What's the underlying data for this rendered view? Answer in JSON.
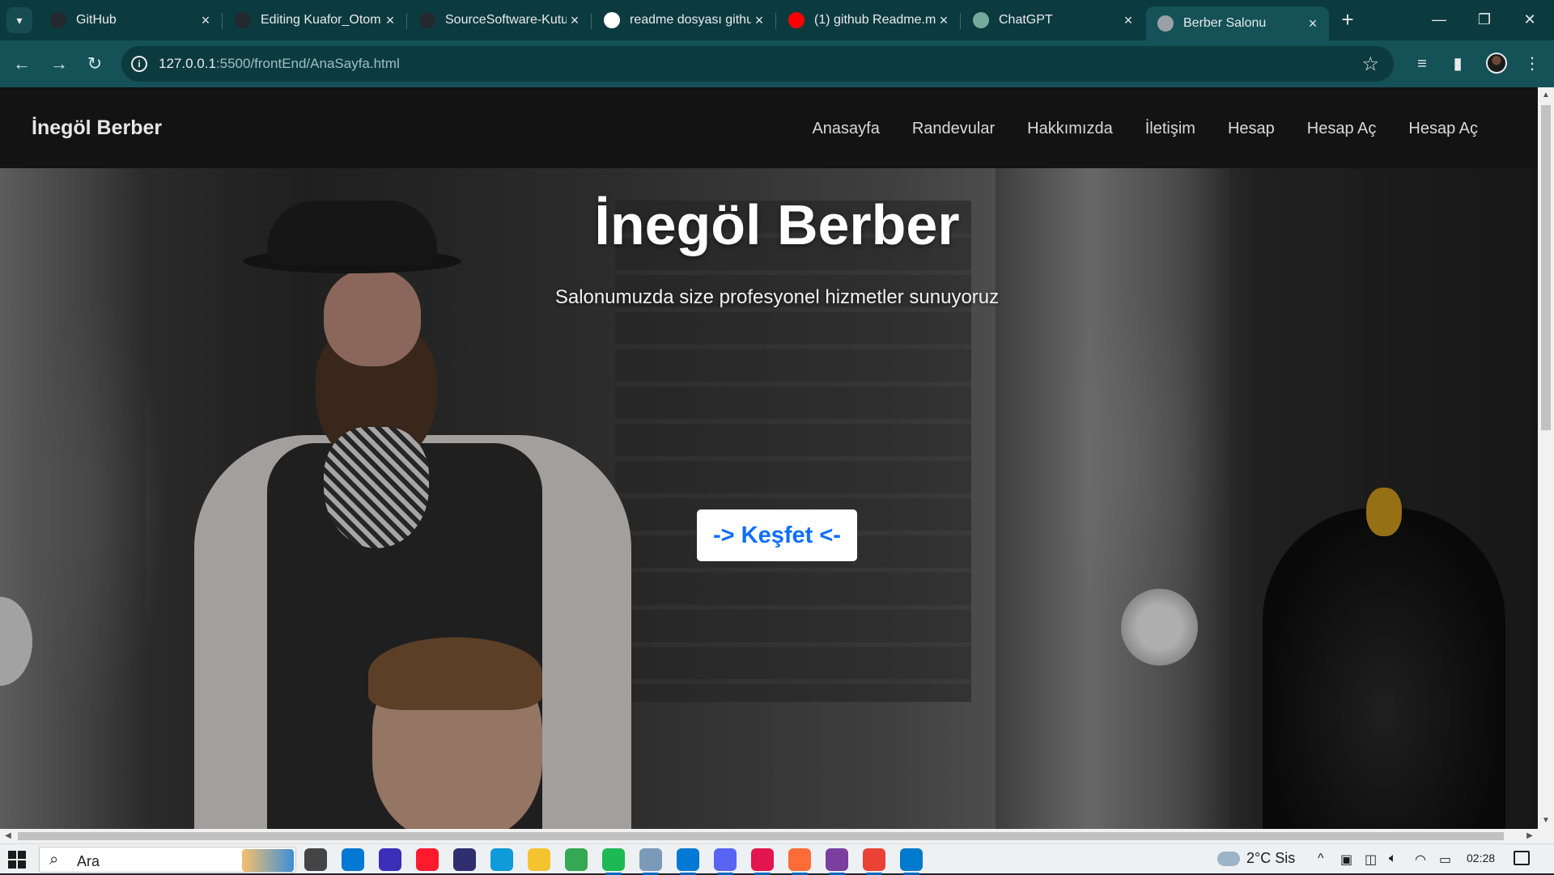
{
  "browser": {
    "tabs": [
      {
        "title": "GitHub",
        "favicon": "github-icon",
        "color": "#24292f"
      },
      {
        "title": "Editing Kuafor_Otom",
        "favicon": "github-icon",
        "color": "#24292f"
      },
      {
        "title": "SourceSoftware-Kutu",
        "favicon": "github-icon",
        "color": "#24292f"
      },
      {
        "title": "readme dosyası githu",
        "favicon": "google-icon",
        "color": "#ffffff"
      },
      {
        "title": "(1) github Readme.m",
        "favicon": "youtube-icon",
        "color": "#ff0000"
      },
      {
        "title": "ChatGPT",
        "favicon": "chatgpt-icon",
        "color": "#74aa9c"
      },
      {
        "title": "Berber Salonu",
        "favicon": "globe-icon",
        "color": "#9aa0a6"
      }
    ],
    "active_tab_index": 6,
    "address": {
      "host": "127.0.0.1",
      "rest": ":5500/frontEnd/AnaSayfa.html"
    },
    "theme_colors": {
      "tabstrip": "#0c3b3f",
      "toolbar": "#145257"
    }
  },
  "page": {
    "brand": "İnegöl Berber",
    "nav": [
      "Anasayfa",
      "Randevular",
      "Hakkımızda",
      "İletişim",
      "Hesap",
      "Hesap Aç",
      "Hesap Aç"
    ],
    "hero": {
      "title": "İnegöl Berber",
      "subtitle": "Salonumuzda size profesyonel hizmetler sunuyoruz",
      "button": "-> Keşfet <-",
      "button_color": "#0d6efd"
    }
  },
  "taskbar": {
    "search_placeholder": "Ara",
    "weather": "2°C  Sis",
    "time": "02:28",
    "apps": [
      {
        "name": "task-view-icon",
        "color": "#444444"
      },
      {
        "name": "mail-icon",
        "color": "#0078d4"
      },
      {
        "name": "pen-app-icon",
        "color": "#3b2fb8"
      },
      {
        "name": "opera-icon",
        "color": "#ff1b2d"
      },
      {
        "name": "app-icon",
        "color": "#2f2f6f"
      },
      {
        "name": "edge-icon",
        "color": "#0f9bd7"
      },
      {
        "name": "file-explorer-icon",
        "color": "#f4c430"
      },
      {
        "name": "chrome-icon",
        "color": "#34a853"
      },
      {
        "name": "spotify-icon",
        "color": "#1db954"
      },
      {
        "name": "app-icon",
        "color": "#7a9ab8"
      },
      {
        "name": "photos-icon",
        "color": "#0078d4"
      },
      {
        "name": "discord-icon",
        "color": "#5865f2"
      },
      {
        "name": "jetbrains-icon",
        "color": "#e2154f"
      },
      {
        "name": "postman-icon",
        "color": "#ff6c37"
      },
      {
        "name": "app-icon",
        "color": "#7b3fa0"
      },
      {
        "name": "chrome-icon",
        "color": "#ea4335"
      },
      {
        "name": "vscode-icon",
        "color": "#007acc"
      }
    ]
  }
}
